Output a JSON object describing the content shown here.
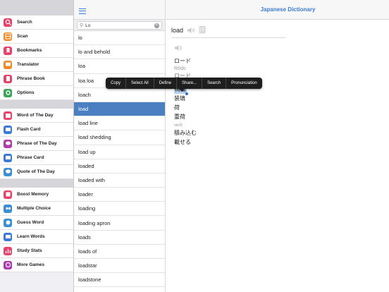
{
  "app": {
    "title": "Japanese Dictionary"
  },
  "sidebar": {
    "groups": [
      [
        {
          "label": "Search",
          "icon": "search-icon",
          "color": "#e8416a"
        },
        {
          "label": "Scan",
          "icon": "scan-icon",
          "color": "#f08a24"
        },
        {
          "label": "Bookmarks",
          "icon": "bookmarks-icon",
          "color": "#e8416a"
        },
        {
          "label": "Translator",
          "icon": "translator-icon",
          "color": "#f08a24"
        },
        {
          "label": "Phrase Book",
          "icon": "phrase-book-icon",
          "color": "#e8416a"
        },
        {
          "label": "Options",
          "icon": "gear-icon",
          "color": "#3aa655"
        }
      ],
      [
        {
          "label": "Word of The Day",
          "icon": "calendar-icon",
          "color": "#e8416a"
        },
        {
          "label": "Flash Card",
          "icon": "flash-card-icon",
          "color": "#3a7bd5"
        },
        {
          "label": "Phrase of The Day",
          "icon": "speech-bubble-icon",
          "color": "#b03ab0"
        },
        {
          "label": "Phrase Card",
          "icon": "phrase-card-icon",
          "color": "#3a7bd5"
        },
        {
          "label": "Quote of The Day",
          "icon": "quote-icon",
          "color": "#3a8fd5"
        }
      ],
      [
        {
          "label": "Boost Memory",
          "icon": "boost-memory-icon",
          "color": "#e8416a"
        },
        {
          "label": "Multiple Choice",
          "icon": "multiple-choice-icon",
          "color": "#3a8fd5"
        },
        {
          "label": "Guess Word",
          "icon": "guess-word-icon",
          "color": "#3a8fd5"
        },
        {
          "label": "Learn Words",
          "icon": "learn-words-icon",
          "color": "#3a7bd5"
        },
        {
          "label": "Study Stats",
          "icon": "stats-icon",
          "color": "#e8416a"
        },
        {
          "label": "More Games",
          "icon": "games-icon",
          "color": "#b03ab0"
        }
      ]
    ]
  },
  "search": {
    "value": "Lo"
  },
  "words": [
    "lo",
    "lo and behold",
    "loa",
    "loa loa",
    "loach",
    "load",
    "load line",
    "load shedding",
    "load up",
    "loaded",
    "loaded with",
    "loader",
    "loading",
    "loading apron",
    "loads",
    "loads of",
    "loadstar",
    "loadstone"
  ],
  "selected_index": 5,
  "detail": {
    "headword": "load",
    "katakana": "ロード",
    "romaji": "Rōdo",
    "strike": "ロード",
    "noun_label": "noun",
    "noun_words": [
      "荷重",
      "装填",
      "荷",
      "重荷"
    ],
    "verb_label": "verb",
    "verb_words": [
      "積み込む",
      "載せる"
    ]
  },
  "context_menu": [
    "Copy",
    "Select All",
    "Define",
    "Share...",
    "Search",
    "Pronunciation"
  ]
}
